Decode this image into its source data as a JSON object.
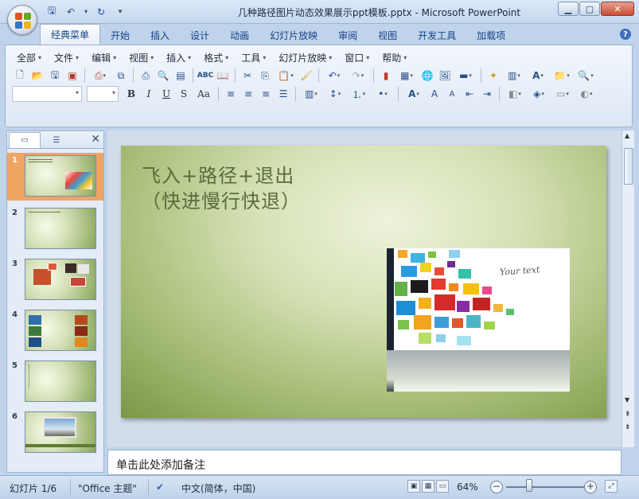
{
  "window": {
    "title": "几种路径图片动态效果展示ppt模板.pptx - Microsoft PowerPoint"
  },
  "ribbon": {
    "tabs": [
      {
        "label": "经典菜单",
        "active": true
      },
      {
        "label": "开始"
      },
      {
        "label": "插入"
      },
      {
        "label": "设计"
      },
      {
        "label": "动画"
      },
      {
        "label": "幻灯片放映"
      },
      {
        "label": "审阅"
      },
      {
        "label": "视图"
      },
      {
        "label": "开发工具"
      },
      {
        "label": "加载项"
      }
    ],
    "menus": [
      "全部",
      "文件",
      "编辑",
      "视图",
      "插入",
      "格式",
      "工具",
      "幻灯片放映",
      "窗口",
      "帮助"
    ],
    "format_buttons": {
      "bold": "B",
      "italic": "I",
      "underline": "U",
      "shadow": "S",
      "case": "Aa"
    }
  },
  "slides_panel": {
    "thumbnails": [
      {
        "number": "1",
        "selected": true
      },
      {
        "number": "2"
      },
      {
        "number": "3"
      },
      {
        "number": "4"
      },
      {
        "number": "5"
      },
      {
        "number": "6"
      }
    ]
  },
  "slide": {
    "title_line1": "飞入+路径+退出",
    "title_line2": "（快进慢行快退）",
    "picture_caption": "Your text",
    "accent_color": "#7e9a4a"
  },
  "notes": {
    "placeholder": "单击此处添加备注"
  },
  "status": {
    "slide_info": "幻灯片 1/6",
    "theme": "\"Office 主题\"",
    "language": "中文(简体，中国)",
    "zoom": "64%",
    "zoom_level_percent": 64
  }
}
